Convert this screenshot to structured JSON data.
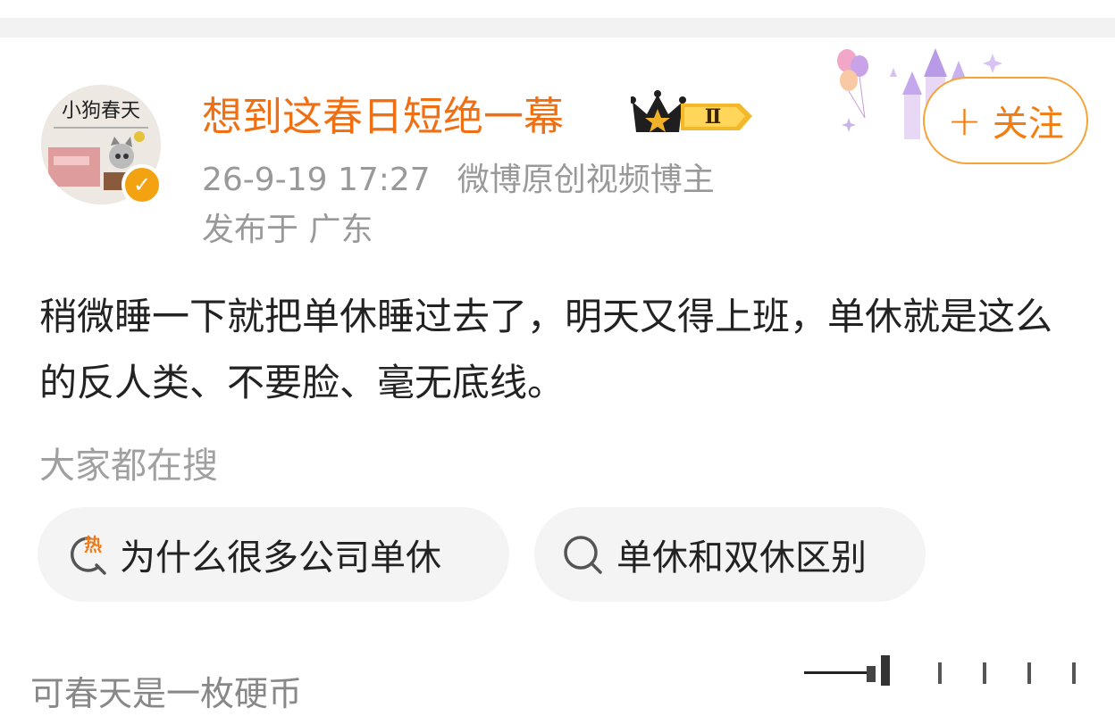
{
  "post": {
    "author": {
      "name": "想到这春日短绝一幕",
      "avatar_text": "小狗春天",
      "verified_icon": "verified-badge-icon",
      "level_badge": "Ⅱ"
    },
    "meta": {
      "time": "26-9-19 17:27",
      "source": "微博原创视频博主",
      "location": "发布于 广东"
    },
    "follow_button": {
      "plus": "+",
      "label": "关注"
    },
    "content": "稍微睡一下就把单休睡过去了，明天又得上班，单休就是这么的反人类、不要脸、毫无底线。"
  },
  "search": {
    "title": "大家都在搜",
    "chips": [
      {
        "label": "为什么很多公司单休",
        "icon": "hot-search-icon",
        "icon_text": "热"
      },
      {
        "label": "单休和双休区别",
        "icon": "search-icon"
      }
    ]
  },
  "next_post": {
    "author": "可春天是一枚硬币"
  },
  "colors": {
    "accent": "#f06f12",
    "follow_border": "#f5a43a",
    "meta_gray": "#999999",
    "chip_bg": "#f4f4f4",
    "verified": "#f3a312"
  }
}
